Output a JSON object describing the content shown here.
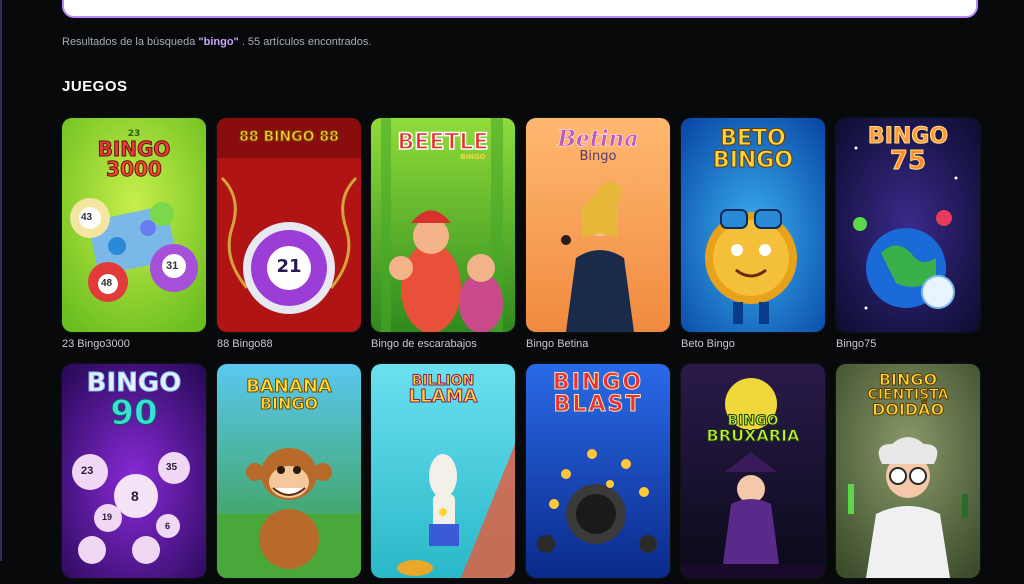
{
  "search": {
    "results_prefix": "Resultados de la búsqueda ",
    "results_term": "\"bingo\"",
    "results_suffix": " . 55 artículos encontrados."
  },
  "section": {
    "title": "JUEGOS"
  },
  "games": [
    {
      "title": "23 Bingo3000",
      "logo_lines": [
        "23",
        "BINGO",
        "3000"
      ]
    },
    {
      "title": "88 Bingo88",
      "logo_lines": [
        "88 BINGO 88",
        "21"
      ]
    },
    {
      "title": "Bingo de escarabajos",
      "logo_lines": [
        "BEETLE",
        "BINGO"
      ]
    },
    {
      "title": "Bingo Betina",
      "logo_lines": [
        "Betina",
        "Bingo"
      ]
    },
    {
      "title": "Beto Bingo",
      "logo_lines": [
        "BETO",
        "BINGO"
      ]
    },
    {
      "title": "Bingo75",
      "logo_lines": [
        "BINGO",
        "75"
      ]
    },
    {
      "title": "",
      "logo_lines": [
        "BINGO",
        "90",
        "23",
        "8",
        "35",
        "19",
        "6"
      ]
    },
    {
      "title": "",
      "logo_lines": [
        "BANANA",
        "BINGO"
      ]
    },
    {
      "title": "",
      "logo_lines": [
        "BILLION",
        "LLAMA"
      ]
    },
    {
      "title": "",
      "logo_lines": [
        "BINGO",
        "BLAST"
      ]
    },
    {
      "title": "",
      "logo_lines": [
        "BINGO",
        "BRUXARIA"
      ]
    },
    {
      "title": "",
      "logo_lines": [
        "BINGO",
        "CIENTISTA",
        "DOIDÃO"
      ]
    }
  ],
  "ball_numbers": [
    "43",
    "31",
    "48"
  ]
}
